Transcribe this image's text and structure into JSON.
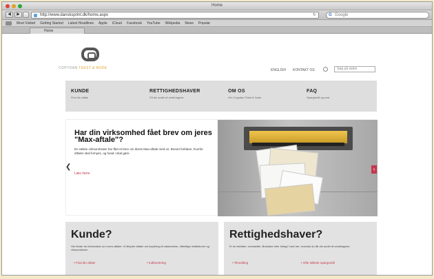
{
  "window": {
    "title": "Home",
    "traffic_lights": [
      "#e0443e",
      "#dea123",
      "#27aa35"
    ]
  },
  "toolbar": {
    "back": "◀",
    "forward": "▶",
    "url": "http://www.dansksprint.dk/home.aspx",
    "reload": "↻",
    "search_provider": "G",
    "search_placeholder": "Google"
  },
  "bookmarks": [
    "Most Visited",
    "Getting Started",
    "Latest Headlines",
    "Apple",
    "iCloud",
    "Facebook",
    "YouTube",
    "Wikipedia",
    "News",
    "Popular"
  ],
  "tab": {
    "label": "Home"
  },
  "site": {
    "logo": {
      "name": "COPYDAN ",
      "accent": "TEKST & NODE"
    },
    "utility": {
      "links": [
        "ENGLISH",
        "KONTAKT OS"
      ],
      "search_placeholder": "Søg på siden"
    },
    "nav": [
      {
        "title": "KUNDE",
        "desc": "Find din aftale"
      },
      {
        "title": "RETTIGHEDSHAVER",
        "desc": "Få din andel af vederlagene"
      },
      {
        "title": "OM OS",
        "desc": "Om Copydan Tekst & Node"
      },
      {
        "title": "FAQ",
        "desc": "Spørgsmål og svar"
      }
    ],
    "hero": {
      "title": "Har din virksomhed fået brev om jeres \"Max-aftale\"?",
      "text": "En række virksomheder har fået et brev om deres Max-aftale med os. Brevet forklarer, hvorfor aftalen skal fornyes, og hvad I skal gøre.",
      "link": "Læs mere",
      "prev": "❮",
      "next": "›"
    },
    "boxes": [
      {
        "title": "Kunde?",
        "text": "Her finder du information om vores aftaler. Vi tilbyder aftaler om kopiering til uddannelse, offentlige institutioner og virksomheder.",
        "links": [
          "Find din aftale",
          "Indberetning"
        ]
      },
      {
        "title": "Rettighedshaver?",
        "text": "Er du forfatter, oversætter, illustrator eller forlag? Læs her, hvordan du får din andel af vederlagene.",
        "links": [
          "Tilmelding",
          "Ofte stillede spørgsmål"
        ]
      }
    ]
  }
}
